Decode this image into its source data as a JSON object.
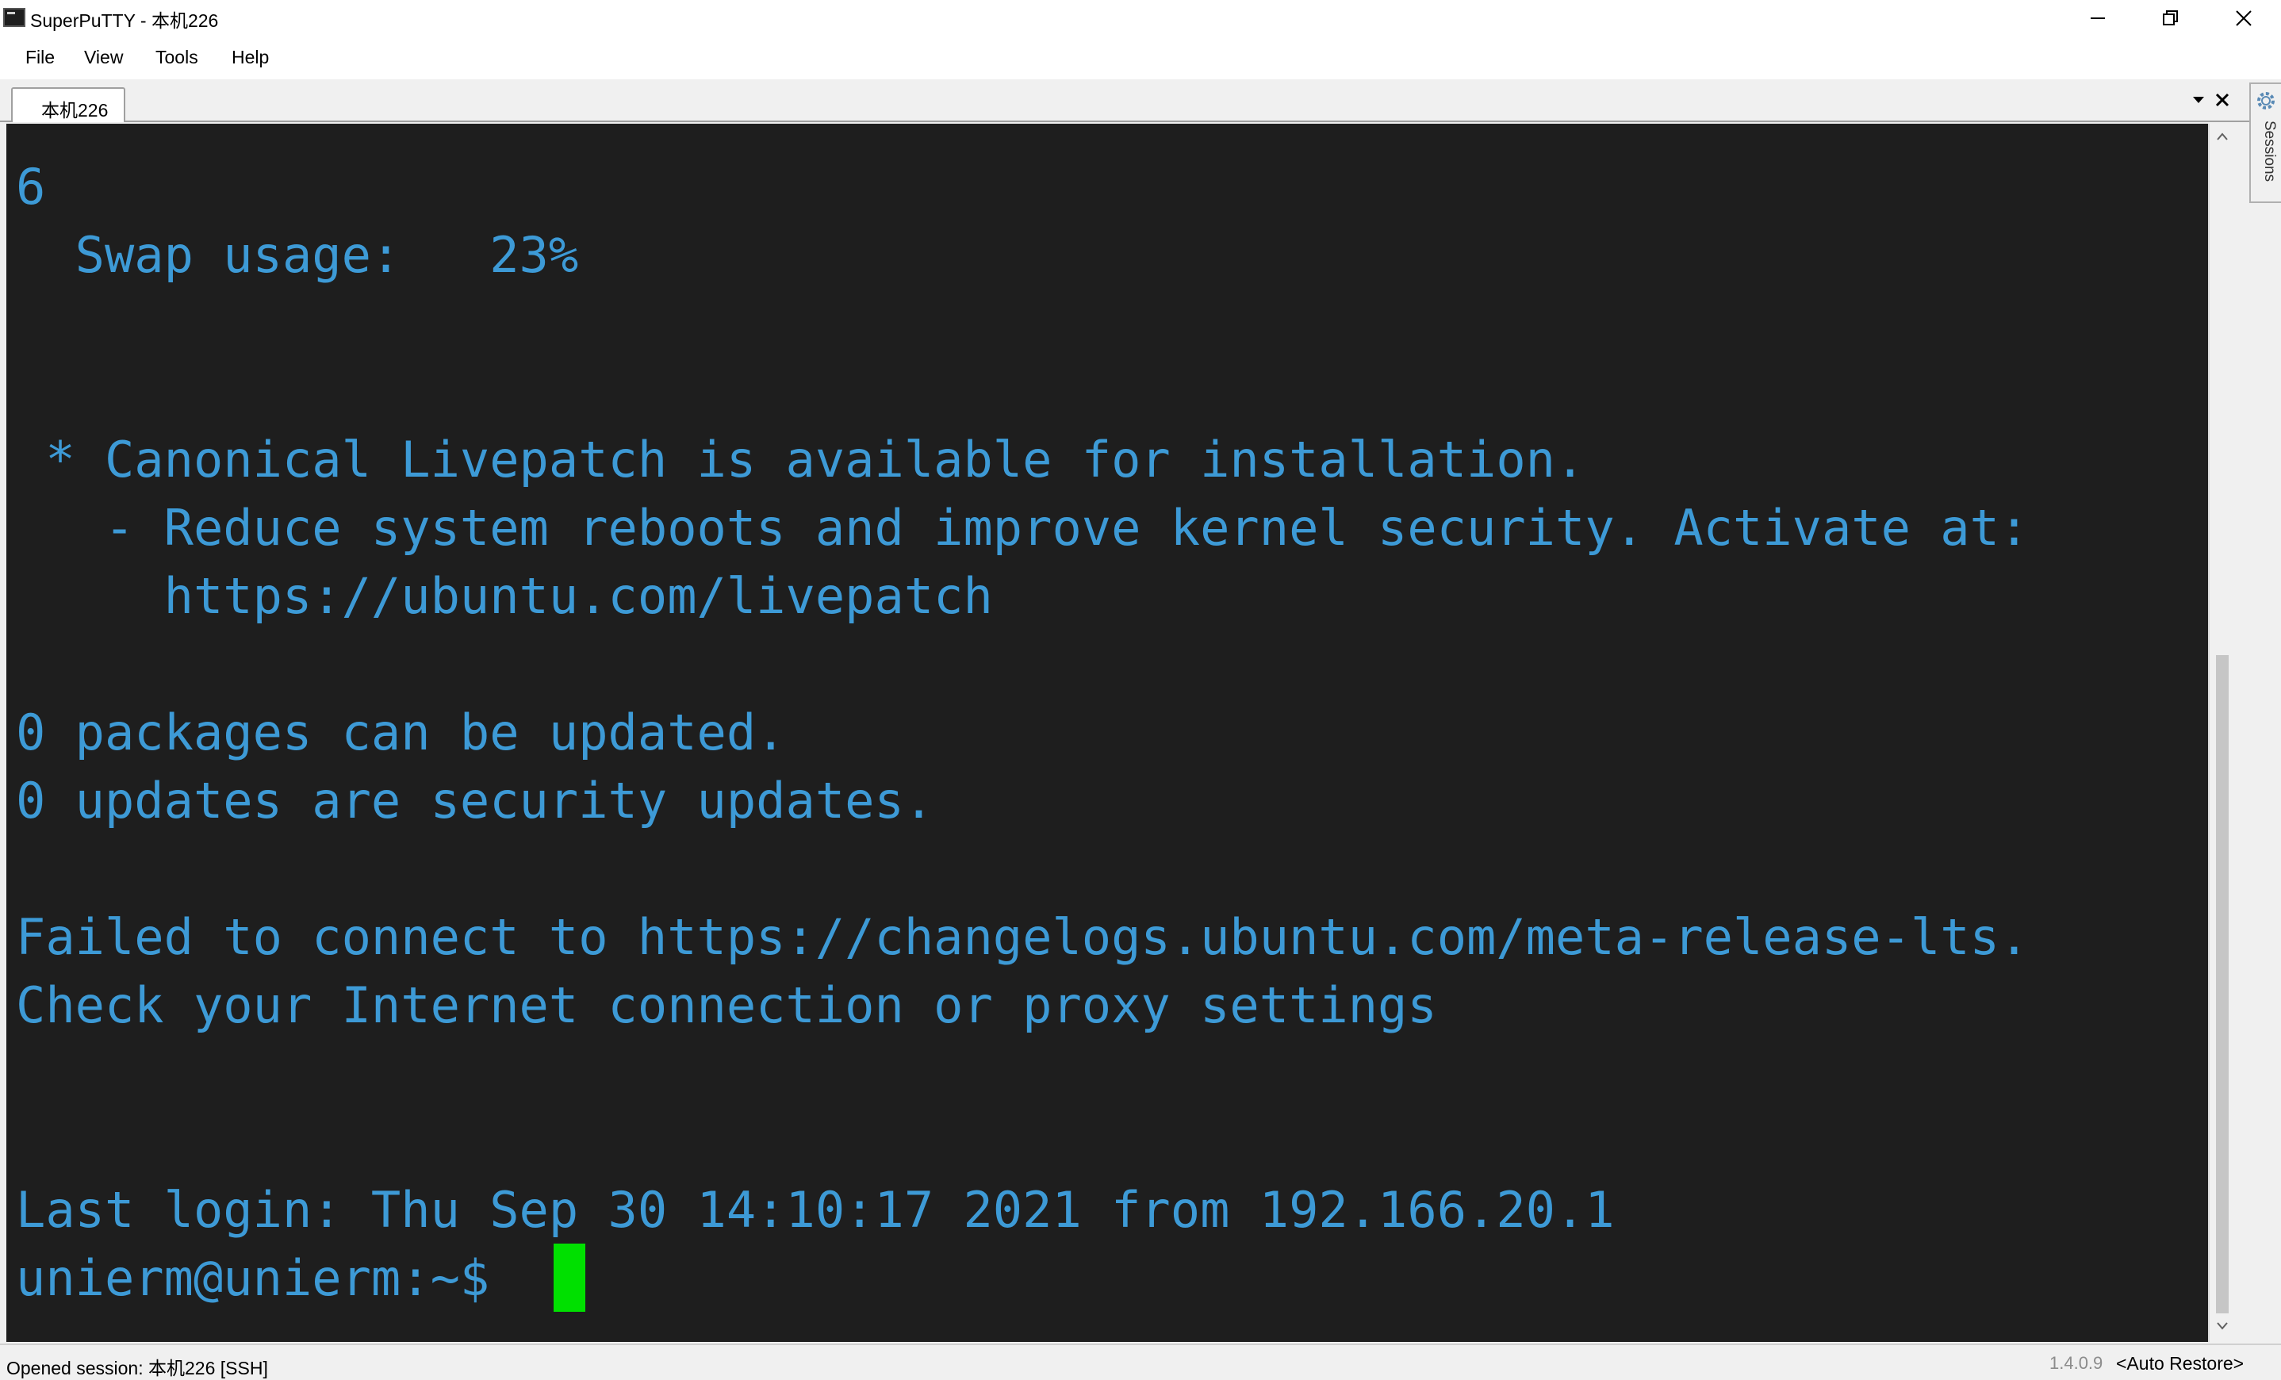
{
  "window": {
    "title": "SuperPuTTY - 本机226",
    "controls": [
      "minimize-icon",
      "restore-icon",
      "close-icon"
    ]
  },
  "menu": {
    "items": [
      {
        "label": "File"
      },
      {
        "label": "View"
      },
      {
        "label": "Tools"
      },
      {
        "label": "Help"
      }
    ]
  },
  "tabs": {
    "active": "本机226",
    "controls": [
      "dropdown-icon",
      "close-tab-icon"
    ]
  },
  "side_panel": {
    "label": "Sessions",
    "icon": "gear-icon"
  },
  "terminal": {
    "lines": [
      "6",
      "  Swap usage:   23%",
      "",
      "",
      " * Canonical Livepatch is available for installation.",
      "   - Reduce system reboots and improve kernel security. Activate at:",
      "     https://ubuntu.com/livepatch",
      "",
      "0 packages can be updated.",
      "0 updates are security updates.",
      "",
      "Failed to connect to https://changelogs.ubuntu.com/meta-release-lts.",
      "Check your Internet connection or proxy settings",
      "",
      "",
      "Last login: Thu Sep 30 14:10:17 2021 from 192.166.20.1",
      "unierm@unierm:~$ "
    ],
    "text_color": "#3d9ad6",
    "background": "#1e1e1e",
    "cursor_color": "#00e000"
  },
  "status": {
    "message": "Opened session: 本机226 [SSH]",
    "version": "1.4.0.9",
    "layout": "<Auto Restore>"
  }
}
